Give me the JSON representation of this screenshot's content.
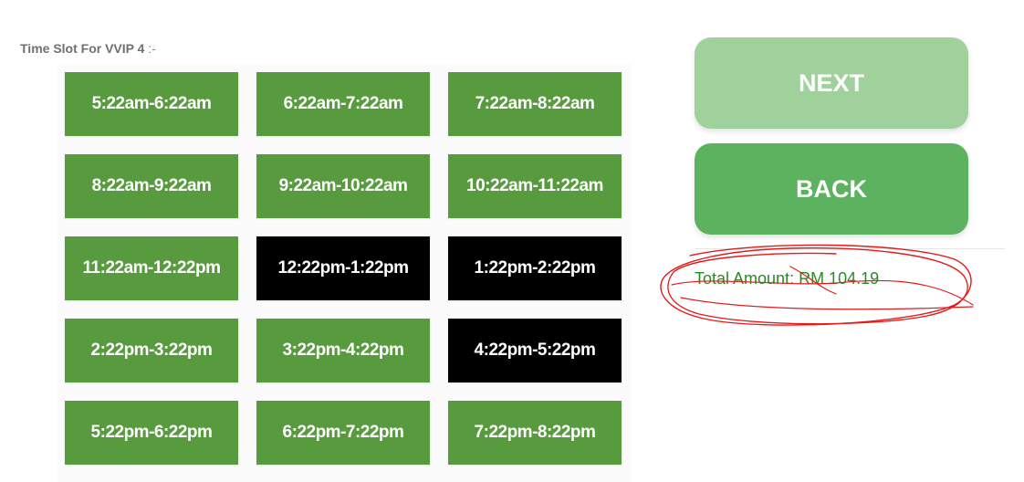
{
  "header": {
    "title": "Time Slot For VVIP 4",
    "separator": ":-"
  },
  "slots": [
    {
      "label": "5:22am-6:22am",
      "state": "available"
    },
    {
      "label": "6:22am-7:22am",
      "state": "available"
    },
    {
      "label": "7:22am-8:22am",
      "state": "available"
    },
    {
      "label": "8:22am-9:22am",
      "state": "available"
    },
    {
      "label": "9:22am-10:22am",
      "state": "available"
    },
    {
      "label": "10:22am-11:22am",
      "state": "available"
    },
    {
      "label": "11:22am-12:22pm",
      "state": "available"
    },
    {
      "label": "12:22pm-1:22pm",
      "state": "booked"
    },
    {
      "label": "1:22pm-2:22pm",
      "state": "booked"
    },
    {
      "label": "2:22pm-3:22pm",
      "state": "available"
    },
    {
      "label": "3:22pm-4:22pm",
      "state": "available"
    },
    {
      "label": "4:22pm-5:22pm",
      "state": "booked"
    },
    {
      "label": "5:22pm-6:22pm",
      "state": "available"
    },
    {
      "label": "6:22pm-7:22pm",
      "state": "available"
    },
    {
      "label": "7:22pm-8:22pm",
      "state": "available"
    }
  ],
  "actions": {
    "next_label": "NEXT",
    "back_label": "BACK"
  },
  "summary": {
    "total_text": "Total Amount: RM 104.19"
  },
  "colors": {
    "slot_available": "#579b3e",
    "slot_booked": "#000000",
    "next_button": "#a0d19d",
    "back_button": "#5cb25e",
    "total_text": "#2c8a2c",
    "annotation_scribble": "#e31b1b"
  }
}
